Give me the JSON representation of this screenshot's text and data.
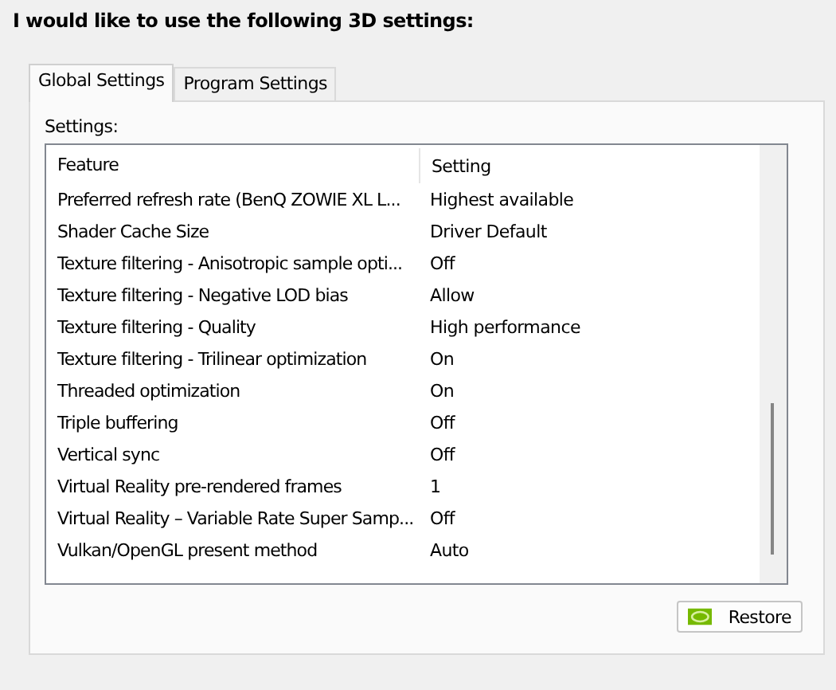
{
  "heading": "I would like to use the following 3D settings:",
  "tabs": [
    {
      "label": "Global Settings",
      "selected": true
    },
    {
      "label": "Program Settings",
      "selected": false
    }
  ],
  "settings_label": "Settings:",
  "table": {
    "columns": [
      "Feature",
      "Setting"
    ],
    "rows": [
      [
        "Preferred refresh rate (BenQ ZOWIE XL L...",
        "Highest available"
      ],
      [
        "Shader Cache Size",
        "Driver Default"
      ],
      [
        "Texture filtering - Anisotropic sample opti...",
        "Off"
      ],
      [
        "Texture filtering - Negative LOD bias",
        "Allow"
      ],
      [
        "Texture filtering - Quality",
        "High performance"
      ],
      [
        "Texture filtering - Trilinear optimization",
        "On"
      ],
      [
        "Threaded optimization",
        "On"
      ],
      [
        "Triple buffering",
        "Off"
      ],
      [
        "Vertical sync",
        "Off"
      ],
      [
        "Virtual Reality pre-rendered frames",
        "1"
      ],
      [
        "Virtual Reality – Variable Rate Super Samp...",
        "Off"
      ],
      [
        "Vulkan/OpenGL present method",
        "Auto"
      ]
    ]
  },
  "restore_button": "Restore"
}
